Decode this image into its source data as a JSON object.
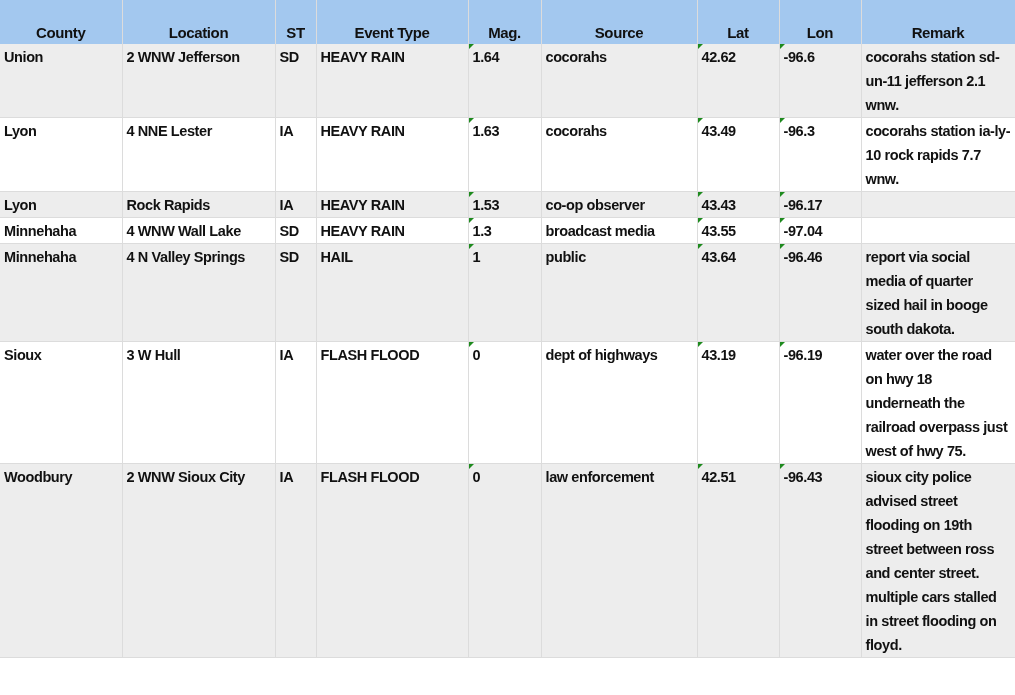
{
  "table": {
    "columns": [
      {
        "label": "County",
        "flagged": false
      },
      {
        "label": "Location",
        "flagged": false
      },
      {
        "label": "ST",
        "flagged": false
      },
      {
        "label": "Event Type",
        "flagged": false
      },
      {
        "label": "Mag.",
        "flagged": true
      },
      {
        "label": "Source",
        "flagged": false
      },
      {
        "label": "Lat",
        "flagged": true
      },
      {
        "label": "Lon",
        "flagged": true
      },
      {
        "label": "Remark",
        "flagged": false
      }
    ],
    "rows": [
      [
        "Union",
        "2 WNW Jefferson",
        "SD",
        "HEAVY RAIN",
        "1.64",
        "cocorahs",
        "42.62",
        "-96.6",
        "cocorahs station sd-un-11 jefferson 2.1 wnw."
      ],
      [
        "Lyon",
        "4 NNE Lester",
        "IA",
        "HEAVY RAIN",
        "1.63",
        "cocorahs",
        "43.49",
        "-96.3",
        "cocorahs station ia-ly-10 rock rapids 7.7 wnw."
      ],
      [
        "Lyon",
        "Rock Rapids",
        "IA",
        "HEAVY RAIN",
        "1.53",
        "co-op observer",
        "43.43",
        "-96.17",
        ""
      ],
      [
        "Minnehaha",
        "4 WNW Wall Lake",
        "SD",
        "HEAVY RAIN",
        "1.3",
        "broadcast media",
        "43.55",
        "-97.04",
        ""
      ],
      [
        "Minnehaha",
        "4 N Valley Springs",
        "SD",
        "HAIL",
        "1",
        "public",
        "43.64",
        "-96.46",
        "report via social media of quarter sized hail in booge south dakota."
      ],
      [
        "Sioux",
        "3 W Hull",
        "IA",
        "FLASH FLOOD",
        "0",
        "dept of highways",
        "43.19",
        "-96.19",
        "water over the road on hwy 18 underneath the railroad overpass just west of hwy 75."
      ],
      [
        "Woodbury",
        "2 WNW Sioux City",
        "IA",
        "FLASH FLOOD",
        "0",
        "law enforcement",
        "42.51",
        "-96.43",
        "sioux city police advised street flooding on 19th street between ross and center street. multiple cars stalled in street flooding on floyd."
      ]
    ]
  }
}
